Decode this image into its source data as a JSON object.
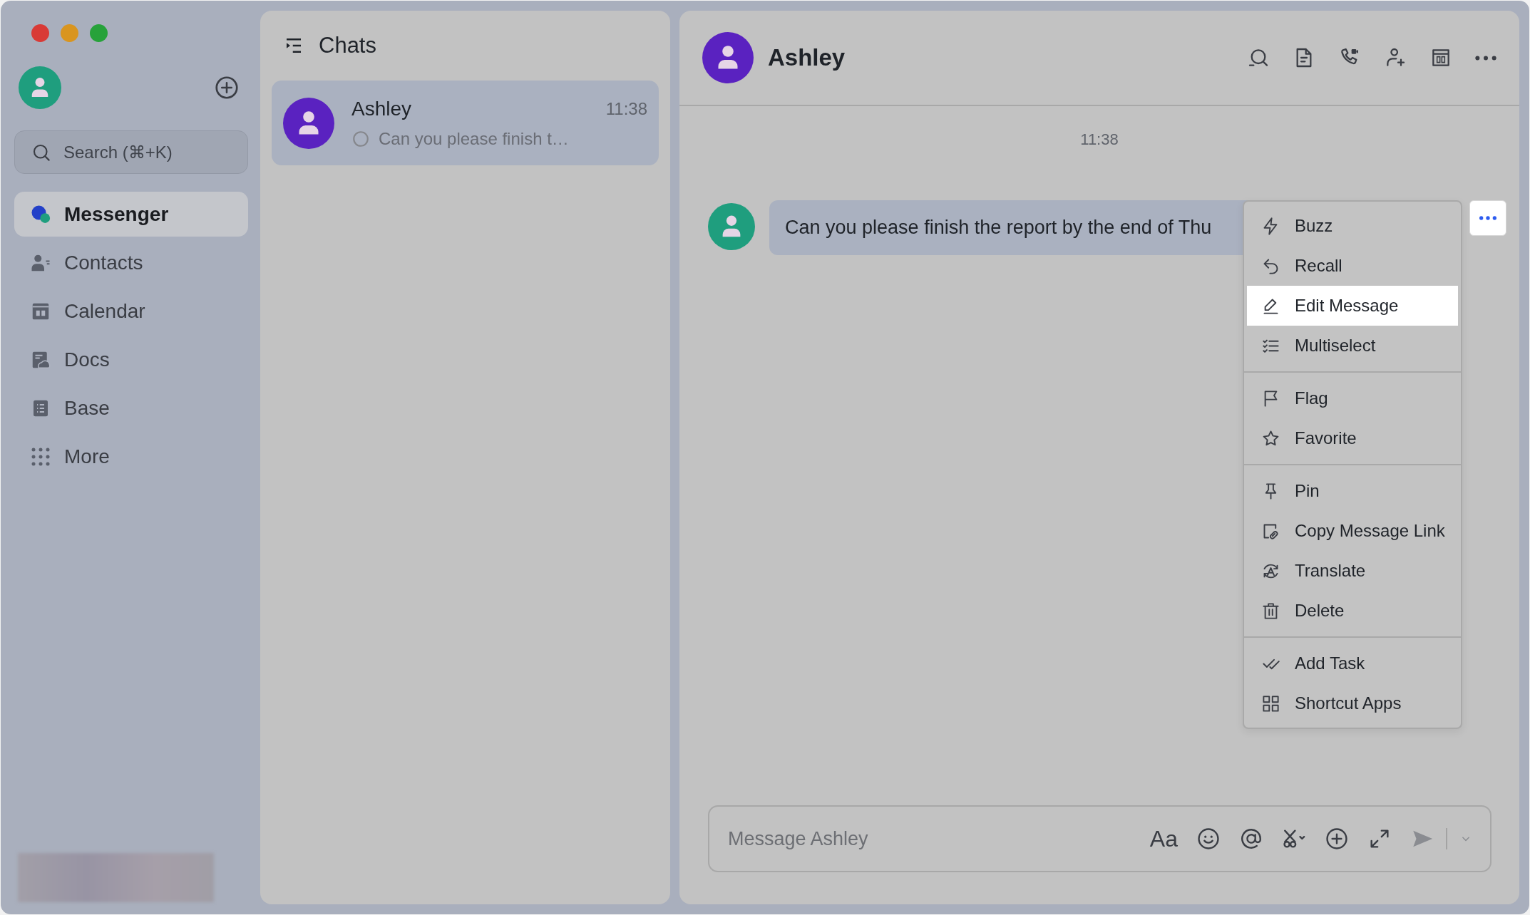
{
  "window": {
    "traffic_lights": [
      {
        "color": "#d93a36"
      },
      {
        "color": "#d9951f"
      },
      {
        "color": "#27a23a"
      }
    ]
  },
  "sidebar": {
    "search": {
      "placeholder": "Search (⌘+K)"
    },
    "items": [
      {
        "label": "Messenger",
        "kind": "messenger",
        "selected": true
      },
      {
        "label": "Contacts",
        "kind": "contacts",
        "selected": false
      },
      {
        "label": "Calendar",
        "kind": "calendar",
        "selected": false
      },
      {
        "label": "Docs",
        "kind": "docs",
        "selected": false
      },
      {
        "label": "Base",
        "kind": "base",
        "selected": false
      },
      {
        "label": "More",
        "kind": "more",
        "selected": false
      }
    ]
  },
  "chats": {
    "title": "Chats",
    "items": [
      {
        "name": "Ashley",
        "time": "11:38",
        "preview": "Can you please finish t…",
        "selected": true
      }
    ]
  },
  "conversation": {
    "title": "Ashley",
    "timestamp": "11:38",
    "messages": [
      {
        "text": "Can you please finish the report by the end of Thu"
      }
    ],
    "input": {
      "placeholder": "Message Ashley",
      "format_label": "Aa"
    }
  },
  "context_menu": {
    "groups": [
      {
        "items": [
          {
            "label": "Buzz",
            "kind": "buzz",
            "selected": false
          },
          {
            "label": "Recall",
            "kind": "recall",
            "selected": false
          },
          {
            "label": "Edit Message",
            "kind": "edit",
            "selected": true
          },
          {
            "label": "Multiselect",
            "kind": "multiselect",
            "selected": false
          }
        ]
      },
      {
        "items": [
          {
            "label": "Flag",
            "kind": "flag",
            "selected": false
          },
          {
            "label": "Favorite",
            "kind": "favorite",
            "selected": false
          }
        ]
      },
      {
        "items": [
          {
            "label": "Pin",
            "kind": "pin",
            "selected": false
          },
          {
            "label": "Copy Message Link",
            "kind": "link",
            "selected": false
          },
          {
            "label": "Translate",
            "kind": "translate",
            "selected": false
          },
          {
            "label": "Delete",
            "kind": "delete",
            "selected": false
          }
        ]
      },
      {
        "items": [
          {
            "label": "Add Task",
            "kind": "task",
            "selected": false
          },
          {
            "label": "Shortcut Apps",
            "kind": "apps",
            "selected": false
          }
        ]
      }
    ]
  }
}
